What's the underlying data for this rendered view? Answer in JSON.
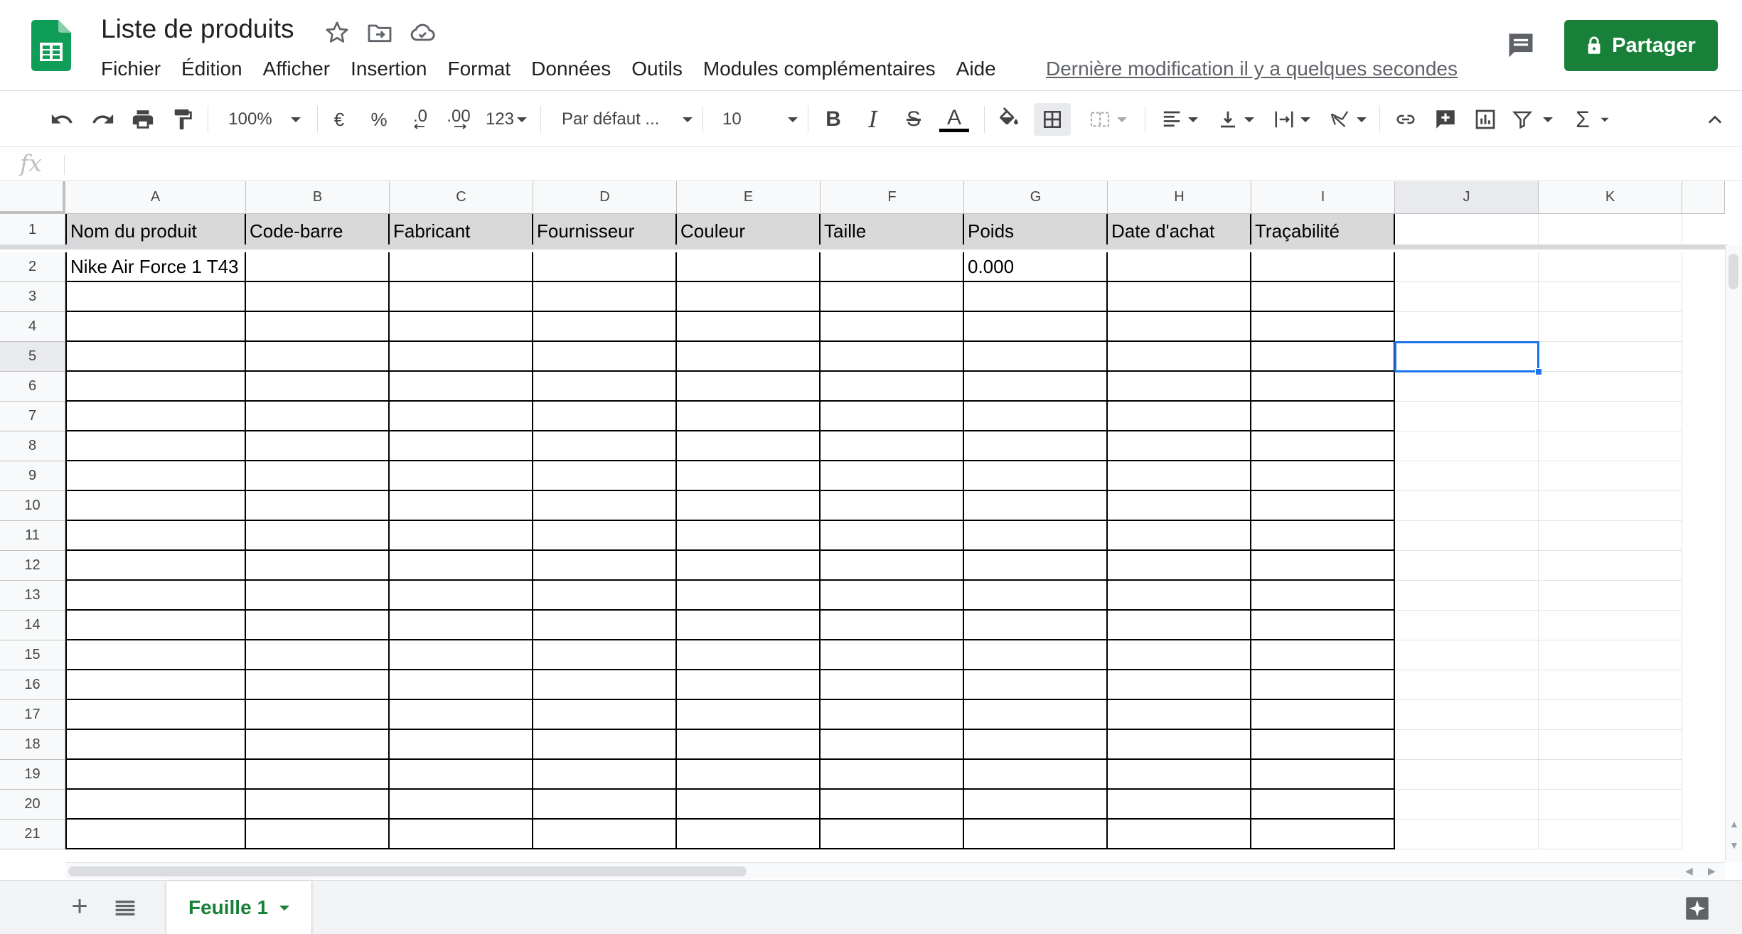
{
  "doc": {
    "title": "Liste de produits",
    "last_edit": "Dernière modification il y a quelques secondes",
    "share_label": "Partager"
  },
  "menu": [
    "Fichier",
    "Édition",
    "Afficher",
    "Insertion",
    "Format",
    "Données",
    "Outils",
    "Modules complémentaires",
    "Aide"
  ],
  "toolbar": {
    "zoom": "100%",
    "currency": "€",
    "percent": "%",
    "dec_decrease": ".0",
    "dec_increase": ".00",
    "more_formats": "123",
    "font": "Par défaut ...",
    "font_size": "10",
    "bold": "B",
    "italic": "I",
    "strike": "S",
    "text_color_letter": "A"
  },
  "formula_bar": {
    "fx": "fx",
    "value": ""
  },
  "columns": [
    "A",
    "B",
    "C",
    "D",
    "E",
    "F",
    "G",
    "H",
    "I",
    "J",
    "K"
  ],
  "rows": [
    "1",
    "2",
    "3",
    "4",
    "5",
    "6",
    "7",
    "8",
    "9",
    "10",
    "11",
    "12",
    "13",
    "14",
    "15",
    "16",
    "17",
    "18",
    "19",
    "20",
    "21"
  ],
  "cells": {
    "header_row": [
      "Nom du produit",
      "Code-barre",
      "Fabricant",
      "Fournisseur",
      "Couleur",
      "Taille",
      "Poids",
      "Date d'achat",
      "Traçabilité"
    ],
    "data_rows": [
      [
        "Nike Air Force 1 T43",
        "",
        "",
        "",
        "",
        "",
        "0.000",
        "",
        ""
      ]
    ]
  },
  "selected_cell": "J5",
  "sheets": {
    "active": "Feuille 1"
  },
  "colors": {
    "accent_green": "#188038",
    "selection_blue": "#1a73e8",
    "header_fill": "#d9d9d9"
  }
}
